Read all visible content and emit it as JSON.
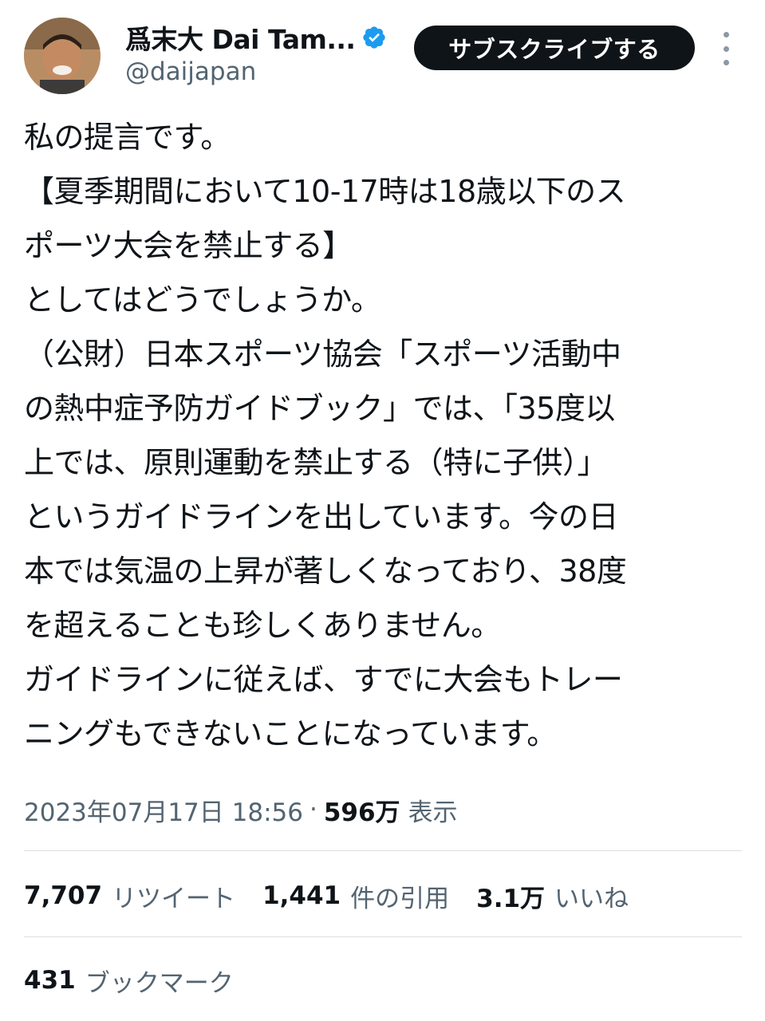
{
  "author": {
    "display_name": "爲末大 Dai Tam...",
    "handle": "@daijapan",
    "verified": true
  },
  "actions": {
    "subscribe_label": "サブスクライブする"
  },
  "tweet": {
    "lines": [
      "私の提言です。",
      "【夏季期間において10-17時は18歳以下のス",
      "ポーツ大会を禁止する】",
      "としてはどうでしょうか。",
      "（公財）日本スポーツ協会「スポーツ活動中",
      "の熱中症予防ガイドブック」では、「35度以",
      "上では、原則運動を禁止する（特に子供）」",
      "というガイドラインを出しています。今の日",
      "本では気温の上昇が著しくなっており、38度",
      "を超えることも珍しくありません。",
      "ガイドラインに従えば、すでに大会もトレー",
      "ニングもできないことになっています。"
    ]
  },
  "meta": {
    "timestamp": "2023年07月17日 18:56",
    "separator": "·",
    "views_count": "596万",
    "views_label": "表示"
  },
  "stats": {
    "retweets": {
      "count": "7,707",
      "label": "リツイート"
    },
    "quotes": {
      "count": "1,441",
      "label": "件の引用"
    },
    "likes": {
      "count": "3.1万",
      "label": "いいね"
    },
    "bookmarks": {
      "count": "431",
      "label": "ブックマーク"
    }
  },
  "colors": {
    "text_primary": "#0f1419",
    "text_secondary": "#536471",
    "verified_badge": "#1d9bf0",
    "subscribe_bg": "#0f1419",
    "divider": "#d9dfe3"
  },
  "icons": {
    "verified": "verified-badge-icon",
    "more": "more-options-icon"
  }
}
